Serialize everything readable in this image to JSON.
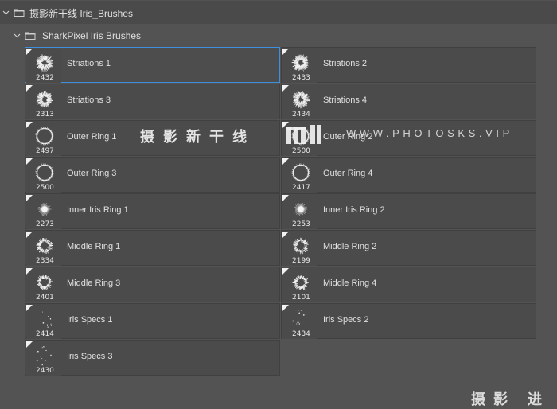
{
  "panel": {
    "group_title": "摄影新干线 Iris_Brushes",
    "subgroup_title": "SharkPixel Iris Brushes"
  },
  "brushes": [
    {
      "name": "Striations 1",
      "size": "2432",
      "style": "striation",
      "selected": true
    },
    {
      "name": "Striations 2",
      "size": "2433",
      "style": "striation"
    },
    {
      "name": "Striations 3",
      "size": "2313",
      "style": "striation"
    },
    {
      "name": "Striations 4",
      "size": "2434",
      "style": "striation"
    },
    {
      "name": "Outer Ring 1",
      "size": "2497",
      "style": "ring"
    },
    {
      "name": "Outer Ring 2",
      "size": "2500",
      "style": "ring"
    },
    {
      "name": "Outer Ring 3",
      "size": "2500",
      "style": "ring"
    },
    {
      "name": "Outer Ring 4",
      "size": "2417",
      "style": "ring"
    },
    {
      "name": "Inner Iris Ring 1",
      "size": "2273",
      "style": "inner"
    },
    {
      "name": "Inner Iris Ring 2",
      "size": "2253",
      "style": "inner"
    },
    {
      "name": "Middle Ring 1",
      "size": "2334",
      "style": "middle"
    },
    {
      "name": "Middle Ring 2",
      "size": "2199",
      "style": "middle"
    },
    {
      "name": "Middle Ring 3",
      "size": "2401",
      "style": "middle"
    },
    {
      "name": "Middle Ring 4",
      "size": "2101",
      "style": "middle"
    },
    {
      "name": "Iris Specs 1",
      "size": "2414",
      "style": "specs"
    },
    {
      "name": "Iris Specs 2",
      "size": "2434",
      "style": "specs"
    },
    {
      "name": "Iris Specs 3",
      "size": "2430",
      "style": "specs"
    }
  ],
  "watermark": {
    "chinese": "摄影新干线",
    "url": "WWW.PHOTOSKS.VIP",
    "bottom_fragment": "摄影 进"
  },
  "colors": {
    "panel_bg": "#535353",
    "tile_bg": "#4b4b4b",
    "selection": "#3e8fdc"
  }
}
